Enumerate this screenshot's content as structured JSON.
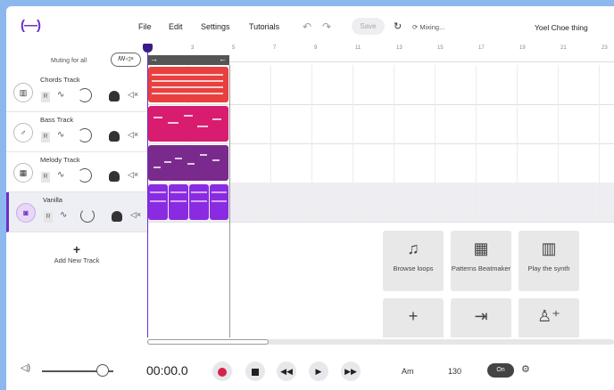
{
  "app": {
    "logo": "(—)",
    "user_name": "Yoel Choe thing"
  },
  "menu": {
    "file": "File",
    "edit": "Edit",
    "settings": "Settings",
    "tutorials": "Tutorials",
    "save": "Save",
    "status": "Mixing..."
  },
  "tracks_header": {
    "muting_label": "Muting for all",
    "mute_toggle": "ꟿ◁×"
  },
  "tracks": [
    {
      "name": "Chords Track",
      "icon": "piano-icon",
      "color": "#e8403f"
    },
    {
      "name": "Bass Track",
      "icon": "guitar-icon",
      "color": "#d81c6f"
    },
    {
      "name": "Melody Track",
      "icon": "keyboard-icon",
      "color": "#7a2a8c"
    },
    {
      "name": "Vanilla",
      "icon": "drum-icon",
      "color": "#8a2be2"
    }
  ],
  "record_label": "R",
  "add_track": {
    "plus": "+",
    "label": "Add New Track"
  },
  "ruler": {
    "marks": [
      "3",
      "5",
      "7",
      "9",
      "11",
      "13",
      "15",
      "17",
      "19",
      "21",
      "23"
    ]
  },
  "tiles": [
    {
      "label": "Browse loops",
      "icon": "♫"
    },
    {
      "label": "Patterns Beatmaker",
      "icon": "▦"
    },
    {
      "label": "Play the synth",
      "icon": "▥"
    },
    {
      "label": "",
      "icon": "+"
    },
    {
      "label": "",
      "icon": "⇥"
    },
    {
      "label": "",
      "icon": "♙⁺"
    }
  ],
  "transport": {
    "time": "00:00.0",
    "key": "Am",
    "tempo": "130",
    "toggle": "On"
  },
  "volume": {
    "level": 0.85
  }
}
